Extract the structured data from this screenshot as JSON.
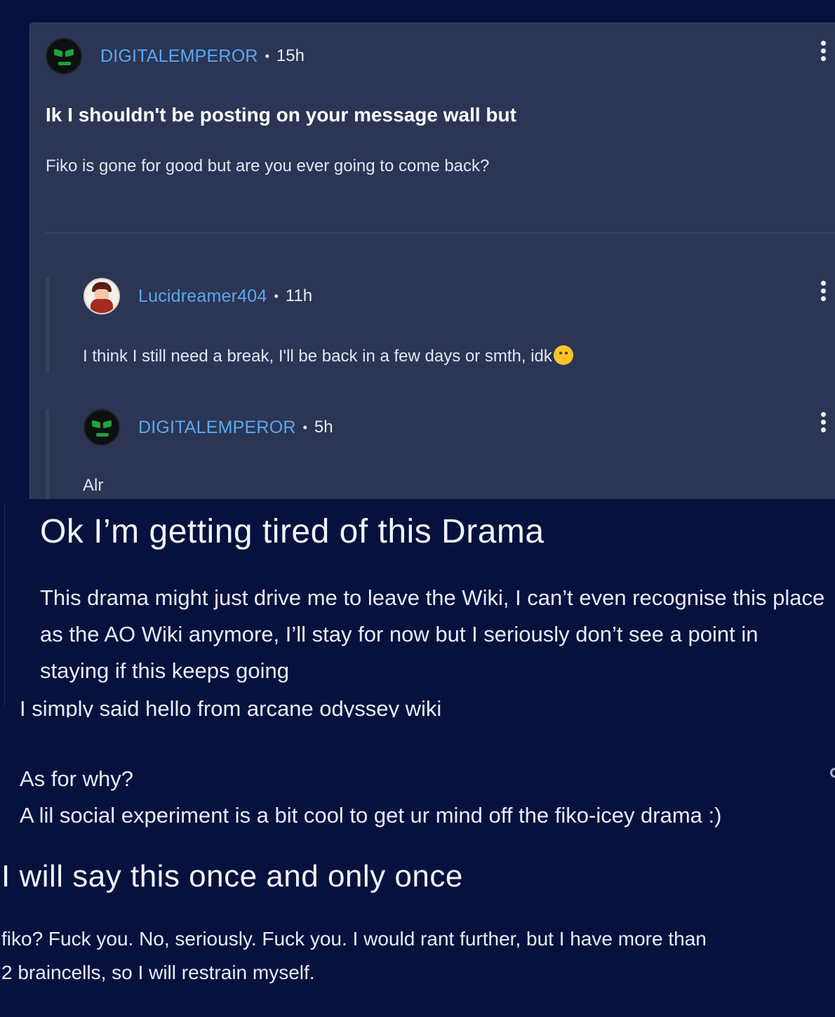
{
  "thread": {
    "post": {
      "author": "DIGITALEMPEROR",
      "time": "15h",
      "title": "Ik I shouldn't be posting on your message wall but",
      "body": "Fiko is gone for good but are you ever going to come back?"
    },
    "replies": [
      {
        "author": "Lucidreamer404",
        "time": "11h",
        "text": "I think I still need a break, I'll be back in a few days or smth, idk",
        "emoji": "worried-face-emoji"
      },
      {
        "author": "DIGITALEMPEROR",
        "time": "5h",
        "text": "Alr"
      }
    ],
    "separator": "•"
  },
  "drama_post": {
    "title": "Ok I’m getting tired of this Drama",
    "lines": [
      "This drama might just drive me to leave the Wiki, I can’t even recognise this place",
      "as the AO Wiki anymore, I’ll stay for now but I seriously don’t see a point in",
      "staying if this keeps going"
    ]
  },
  "hello_post": {
    "cut_line": "I simply said hello from arcane odyssey wiki",
    "why_label": "As for why?",
    "why_body": "A lil social experiment is a bit cool to get ur mind off the fiko-icey drama :)"
  },
  "once_post": {
    "title": "I will say this once and only once",
    "lines": [
      "fiko? Fuck you. No, seriously. Fuck you. I would rant further, but I have more than",
      "2 braincells, so I will restrain myself."
    ]
  },
  "colors": {
    "page_bg": "#06123d",
    "card_bg": "#2c3554",
    "username": "#5aa9ee"
  }
}
